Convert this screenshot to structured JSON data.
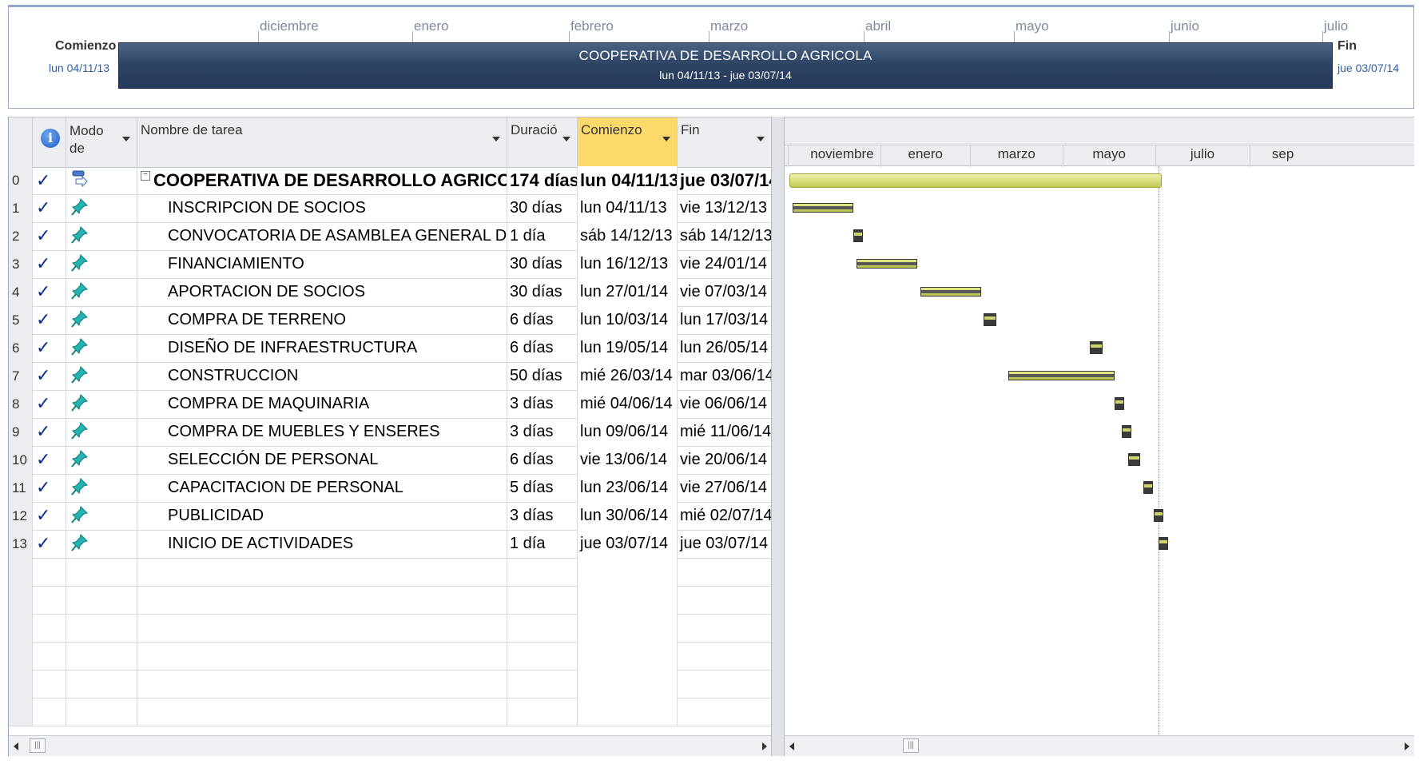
{
  "timeline": {
    "months": [
      "diciembre",
      "enero",
      "febrero",
      "marzo",
      "abril",
      "mayo",
      "junio",
      "julio"
    ],
    "start_label": "Comienzo",
    "start_date": "lun 04/11/13",
    "end_label": "Fin",
    "end_date": "jue 03/07/14",
    "bar_title": "COOPERATIVA DE DESARROLLO AGRICOLA",
    "bar_dates": "lun 04/11/13 - jue 03/07/14"
  },
  "grid": {
    "headers": {
      "mode": "Modo de",
      "name": "Nombre de tarea",
      "duration": "Duració",
      "start": "Comienzo",
      "finish": "Fin"
    },
    "rows": [
      {
        "id": "0",
        "name": "COOPERATIVA DE DESARROLLO AGRICOLA",
        "duration": "174 días",
        "start": "lun 04/11/13",
        "finish": "jue 03/07/14"
      },
      {
        "id": "1",
        "name": "INSCRIPCION DE SOCIOS",
        "duration": "30 días",
        "start": "lun 04/11/13",
        "finish": "vie 13/12/13"
      },
      {
        "id": "2",
        "name": "CONVOCATORIA DE ASAMBLEA GENERAL DE SOCIO",
        "duration": "1 día",
        "start": "sáb 14/12/13",
        "finish": "sáb 14/12/13"
      },
      {
        "id": "3",
        "name": "FINANCIAMIENTO",
        "duration": "30 días",
        "start": "lun 16/12/13",
        "finish": "vie 24/01/14"
      },
      {
        "id": "4",
        "name": "APORTACION DE SOCIOS",
        "duration": "30 días",
        "start": "lun 27/01/14",
        "finish": "vie 07/03/14"
      },
      {
        "id": "5",
        "name": "COMPRA DE TERRENO",
        "duration": "6 días",
        "start": "lun 10/03/14",
        "finish": "lun 17/03/14"
      },
      {
        "id": "6",
        "name": "DISEÑO DE INFRAESTRUCTURA",
        "duration": "6 días",
        "start": "lun 19/05/14",
        "finish": "lun 26/05/14"
      },
      {
        "id": "7",
        "name": "CONSTRUCCION",
        "duration": "50 días",
        "start": "mié 26/03/14",
        "finish": "mar 03/06/14"
      },
      {
        "id": "8",
        "name": "COMPRA DE MAQUINARIA",
        "duration": "3 días",
        "start": "mié 04/06/14",
        "finish": "vie 06/06/14"
      },
      {
        "id": "9",
        "name": "COMPRA DE MUEBLES Y ENSERES",
        "duration": "3 días",
        "start": "lun 09/06/14",
        "finish": "mié 11/06/14"
      },
      {
        "id": "10",
        "name": "SELECCIÓN DE PERSONAL",
        "duration": "6 días",
        "start": "vie 13/06/14",
        "finish": "vie 20/06/14"
      },
      {
        "id": "11",
        "name": "CAPACITACION DE PERSONAL",
        "duration": "5 días",
        "start": "lun 23/06/14",
        "finish": "vie 27/06/14"
      },
      {
        "id": "12",
        "name": "PUBLICIDAD",
        "duration": "3 días",
        "start": "lun 30/06/14",
        "finish": "mié 02/07/14"
      },
      {
        "id": "13",
        "name": "INICIO DE ACTIVIDADES",
        "duration": "1 día",
        "start": "jue 03/07/14",
        "finish": "jue 03/07/14"
      }
    ]
  },
  "gantt": {
    "scale_months": [
      "noviembre",
      "enero",
      "marzo",
      "mayo",
      "julio",
      "sep"
    ],
    "tasks": [
      {
        "id": 1,
        "start": "2013-11-04",
        "finish": "2013-12-13"
      },
      {
        "id": 2,
        "start": "2013-12-14",
        "finish": "2013-12-14"
      },
      {
        "id": 3,
        "start": "2013-12-16",
        "finish": "2014-01-24"
      },
      {
        "id": 4,
        "start": "2014-01-27",
        "finish": "2014-03-07"
      },
      {
        "id": 5,
        "start": "2014-03-10",
        "finish": "2014-03-17"
      },
      {
        "id": 6,
        "start": "2014-05-19",
        "finish": "2014-05-26"
      },
      {
        "id": 7,
        "start": "2014-03-26",
        "finish": "2014-06-03"
      },
      {
        "id": 8,
        "start": "2014-06-04",
        "finish": "2014-06-06"
      },
      {
        "id": 9,
        "start": "2014-06-09",
        "finish": "2014-06-11"
      },
      {
        "id": 10,
        "start": "2014-06-13",
        "finish": "2014-06-20"
      },
      {
        "id": 11,
        "start": "2014-06-23",
        "finish": "2014-06-27"
      },
      {
        "id": 12,
        "start": "2014-06-30",
        "finish": "2014-07-02"
      },
      {
        "id": 13,
        "start": "2014-07-03",
        "finish": "2014-07-03"
      }
    ],
    "summary": {
      "start": "2013-11-04",
      "finish": "2014-07-03"
    },
    "colors": {
      "bar": "#d6dc6e",
      "summary": "#d8de7a",
      "progress": "#595959",
      "timeline_bar": "#2f4566",
      "active_header": "#fbd96a"
    }
  }
}
